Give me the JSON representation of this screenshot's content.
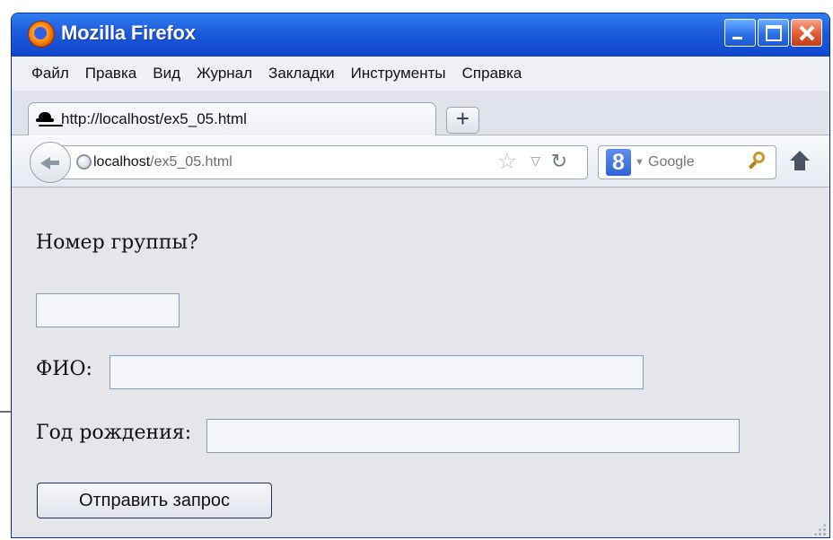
{
  "window": {
    "title": "Mozilla Firefox"
  },
  "menu": {
    "items": [
      "Файл",
      "Правка",
      "Вид",
      "Журнал",
      "Закладки",
      "Инструменты",
      "Справка"
    ]
  },
  "tab": {
    "title": "http://localhost/ex5_05.html",
    "new_tab_label": "+"
  },
  "navigation": {
    "url_host": "localhost",
    "url_path": "/ex5_05.html",
    "search_engine": "Google"
  },
  "form": {
    "question": "Номер группы?",
    "group_value": "",
    "fio_label": "ФИО:",
    "fio_value": "",
    "year_label": "Год рождения:",
    "year_value": "",
    "submit_label": "Отправить запрос"
  }
}
